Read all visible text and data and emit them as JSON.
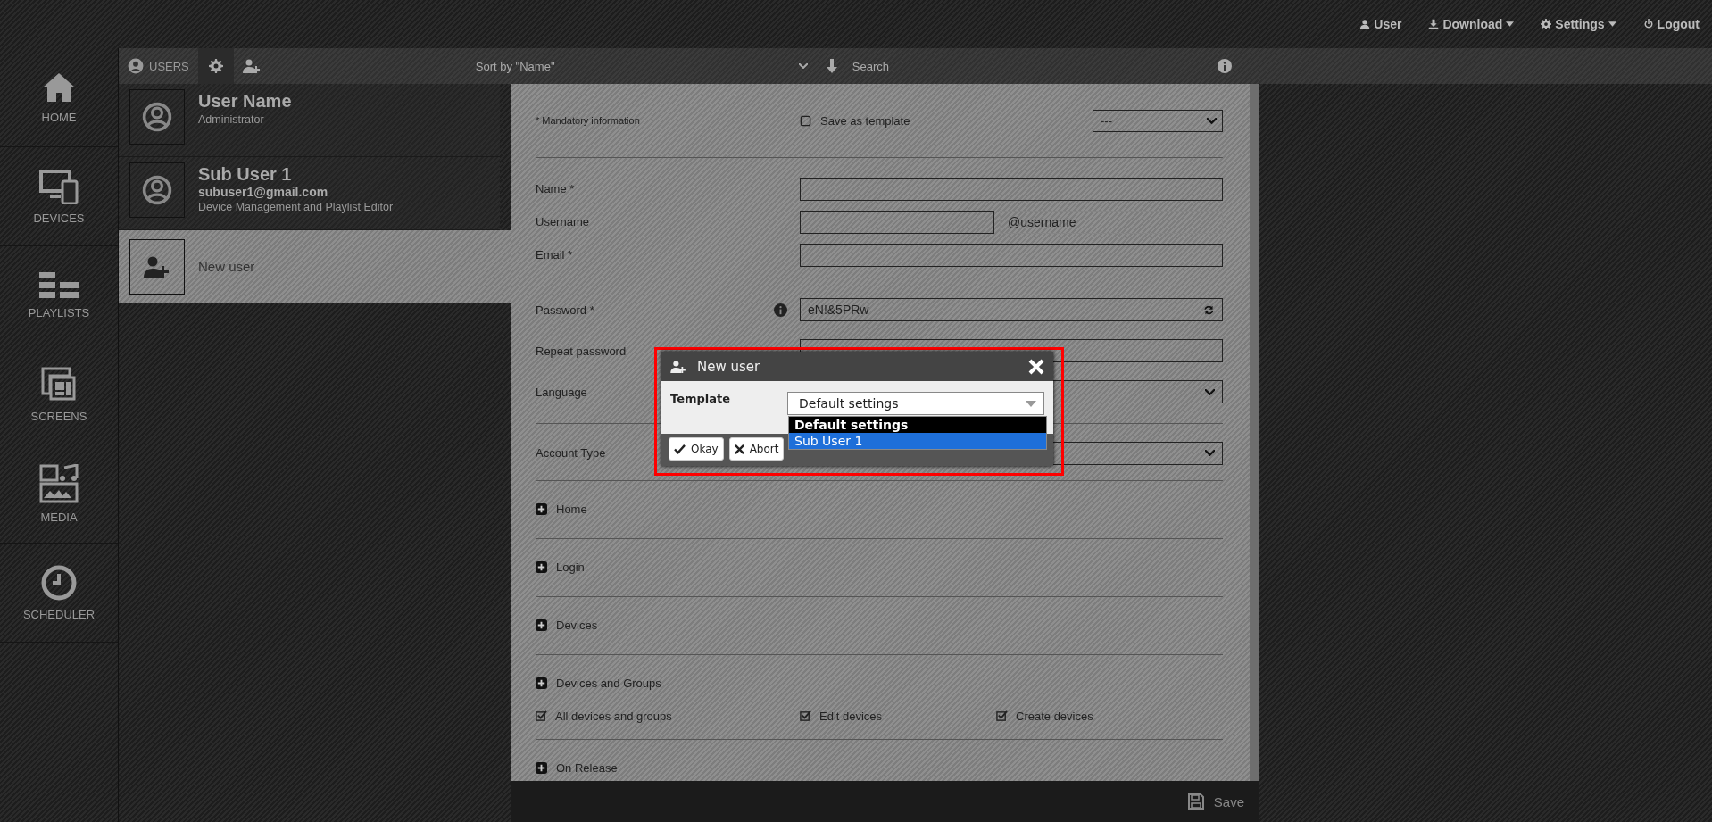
{
  "topbar": {
    "menu": [
      {
        "label": "User",
        "dropdown": false
      },
      {
        "label": "Download",
        "dropdown": true
      },
      {
        "label": "Settings",
        "dropdown": true
      },
      {
        "label": "Logout",
        "dropdown": false
      }
    ]
  },
  "nav": {
    "items": [
      {
        "label": "HOME"
      },
      {
        "label": "DEVICES"
      },
      {
        "label": "PLAYLISTS"
      },
      {
        "label": "SCREENS"
      },
      {
        "label": "MEDIA"
      },
      {
        "label": "SCHEDULER"
      }
    ]
  },
  "toolbar": {
    "tab": "USERS",
    "sort": "Sort by \"Name\"",
    "search_placeholder": "Search"
  },
  "users": [
    {
      "kind": "user",
      "name": "User Name",
      "lines": [
        "Administrator"
      ],
      "selected": false
    },
    {
      "kind": "user",
      "name": "Sub User 1",
      "email": "subuser1@gmail.com",
      "lines": [
        "Device Management and Playlist Editor"
      ],
      "selected": false
    },
    {
      "kind": "new",
      "name": "New user",
      "selected": true
    }
  ],
  "form": {
    "mandatory_note": "* Mandatory information",
    "save_template": {
      "label": "Save as template",
      "checked": false
    },
    "template_select": "---",
    "groups": [
      {
        "ruled": true,
        "fields": [
          {
            "kind": "text",
            "label": "Name *"
          },
          {
            "kind": "suffix",
            "label": "Username",
            "suffix": "@username"
          },
          {
            "kind": "text",
            "label": "Email *"
          }
        ]
      },
      {
        "ruled": false,
        "fields": [
          {
            "kind": "password",
            "label": "Password *",
            "value": "eN!&5PRw"
          },
          {
            "kind": "text",
            "label": "Repeat password"
          },
          {
            "kind": "select",
            "label": "Language"
          }
        ]
      },
      {
        "ruled": true,
        "fields": [
          {
            "kind": "select",
            "label": "Account Type"
          }
        ]
      }
    ],
    "sections": [
      {
        "title": "Home"
      },
      {
        "title": "Login"
      },
      {
        "title": "Devices"
      },
      {
        "title": "Devices and Groups",
        "options": [
          {
            "label": "All devices and groups",
            "checked": true
          },
          {
            "label": "Edit devices",
            "checked": true
          },
          {
            "label": "Create devices",
            "checked": true
          }
        ]
      },
      {
        "title": "On Release"
      }
    ]
  },
  "dialog": {
    "title": "New user",
    "template_label": "Template",
    "template_value": "Default settings",
    "options": [
      {
        "label": "Default settings",
        "current": true,
        "selected": false
      },
      {
        "label": "Sub User 1",
        "current": false,
        "selected": true
      }
    ],
    "buttons": [
      "Okay",
      "Abort"
    ]
  },
  "footer": {
    "save": "Save"
  }
}
